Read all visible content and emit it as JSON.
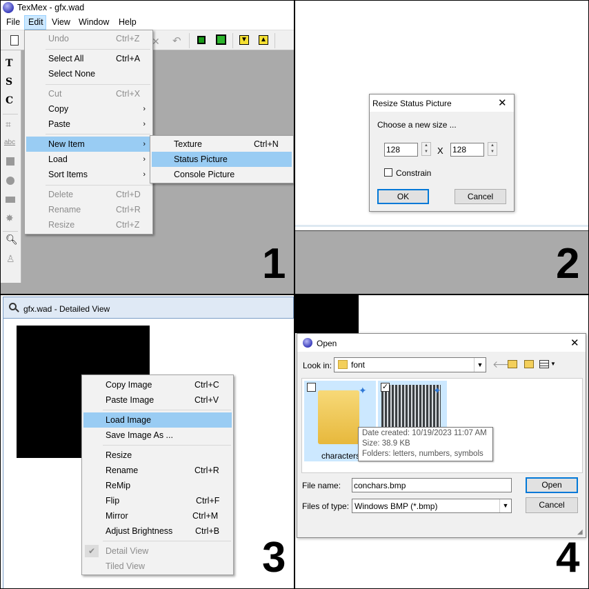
{
  "panel1": {
    "title": "TexMex - gfx.wad",
    "menubar": [
      "File",
      "Edit",
      "View",
      "Window",
      "Help"
    ],
    "edit_menu": [
      {
        "label": "Undo",
        "shortcut": "Ctrl+Z",
        "disabled": true
      },
      {
        "label": "Select All",
        "shortcut": "Ctrl+A"
      },
      {
        "label": "Select None",
        "shortcut": ""
      },
      {
        "label": "Cut",
        "shortcut": "Ctrl+X",
        "disabled": true
      },
      {
        "label": "Copy",
        "shortcut": "",
        "submenu": true
      },
      {
        "label": "Paste",
        "shortcut": "",
        "submenu": true
      },
      {
        "label": "New Item",
        "shortcut": "",
        "submenu": true,
        "highlighted": true
      },
      {
        "label": "Load",
        "shortcut": "",
        "submenu": true
      },
      {
        "label": "Sort Items",
        "shortcut": "",
        "submenu": true
      },
      {
        "label": "Delete",
        "shortcut": "Ctrl+D",
        "disabled": true
      },
      {
        "label": "Rename",
        "shortcut": "Ctrl+R",
        "disabled": true
      },
      {
        "label": "Resize",
        "shortcut": "Ctrl+Z",
        "disabled": true
      }
    ],
    "new_item_submenu": [
      {
        "label": "Texture",
        "shortcut": "Ctrl+N"
      },
      {
        "label": "Status Picture",
        "shortcut": "",
        "highlighted": true
      },
      {
        "label": "Console Picture",
        "shortcut": ""
      }
    ],
    "number": "1"
  },
  "panel2": {
    "dialog_title": "Resize Status Picture",
    "prompt": "Choose a new size ...",
    "width_value": "128",
    "height_value": "128",
    "times": "X",
    "constrain_label": "Constrain",
    "ok_label": "OK",
    "cancel_label": "Cancel",
    "number": "2"
  },
  "panel3": {
    "window_title": "gfx.wad - Detailed View",
    "context_menu": [
      {
        "label": "Copy Image",
        "shortcut": "Ctrl+C"
      },
      {
        "label": "Paste Image",
        "shortcut": "Ctrl+V"
      },
      {
        "label": "Load Image",
        "shortcut": "",
        "highlighted": true
      },
      {
        "label": "Save Image As ...",
        "shortcut": ""
      },
      {
        "label": "Resize",
        "shortcut": ""
      },
      {
        "label": "Rename",
        "shortcut": "Ctrl+R"
      },
      {
        "label": "ReMip",
        "shortcut": ""
      },
      {
        "label": "Flip",
        "shortcut": "Ctrl+F"
      },
      {
        "label": "Mirror",
        "shortcut": "Ctrl+M"
      },
      {
        "label": "Adjust Brightness",
        "shortcut": "Ctrl+B"
      },
      {
        "label": "Detail View",
        "shortcut": "",
        "disabled": true,
        "checked": true
      },
      {
        "label": "Tiled View",
        "shortcut": "",
        "disabled": true
      }
    ],
    "number": "3"
  },
  "panel4": {
    "dialog_title": "Open",
    "look_in_label": "Look in:",
    "look_in_value": "font",
    "folder_name": "characters",
    "tooltip": [
      "Date created: 10/19/2023 11:07 AM",
      "Size: 38.9 KB",
      "Folders: letters, numbers, symbols"
    ],
    "file_name_label": "File name:",
    "file_name_value": "conchars.bmp",
    "files_of_type_label": "Files of type:",
    "files_of_type_value": "Windows BMP (*.bmp)",
    "open_label": "Open",
    "cancel_label": "Cancel",
    "number": "4"
  }
}
